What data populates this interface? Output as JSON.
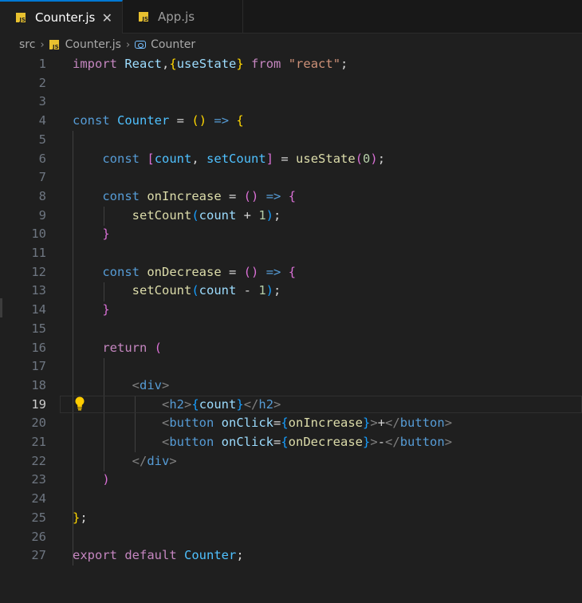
{
  "tabs": [
    {
      "label": "Counter.js",
      "active": true,
      "icon": "js-file-icon"
    },
    {
      "label": "App.js",
      "active": false,
      "icon": "js-file-icon"
    }
  ],
  "breadcrumb": {
    "folder": "src",
    "file": "Counter.js",
    "symbol": "Counter"
  },
  "editor": {
    "current_line": 19,
    "line_numbers": [
      "1",
      "2",
      "3",
      "4",
      "5",
      "6",
      "7",
      "8",
      "9",
      "10",
      "11",
      "12",
      "13",
      "14",
      "15",
      "16",
      "17",
      "18",
      "19",
      "20",
      "21",
      "22",
      "23",
      "24",
      "25",
      "26",
      "27"
    ]
  },
  "code": {
    "l1": {
      "import": "import",
      "react": "React",
      "comma": ",",
      "ob": "{",
      "usestate": "useState",
      "cb": "}",
      "from": "from",
      "module": "\"react\"",
      "semi": ";"
    },
    "l4": {
      "const": "const",
      "name": "Counter",
      "eq": " = ",
      "op": "(",
      "cp": ")",
      "arrow": " => ",
      "ob": "{"
    },
    "l6": {
      "const": "const",
      "ob": "[",
      "count": "count",
      "comma": ", ",
      "setcount": "setCount",
      "cb": "]",
      "eq": " = ",
      "fn": "useState",
      "op": "(",
      "zero": "0",
      "cp": ")",
      "semi": ";"
    },
    "l8": {
      "const": "const",
      "name": "onIncrease",
      "eq": " = ",
      "op": "(",
      "cp": ")",
      "arrow": " => ",
      "ob": "{"
    },
    "l9": {
      "fn": "setCount",
      "op": "(",
      "count": "count",
      "plus": " + ",
      "one": "1",
      "cp": ")",
      "semi": ";"
    },
    "l10": {
      "cb": "}"
    },
    "l12": {
      "const": "const",
      "name": "onDecrease",
      "eq": " = ",
      "op": "(",
      "cp": ")",
      "arrow": " => ",
      "ob": "{"
    },
    "l13": {
      "fn": "setCount",
      "op": "(",
      "count": "count",
      "minus": " - ",
      "one": "1",
      "cp": ")",
      "semi": ";"
    },
    "l14": {
      "cb": "}"
    },
    "l16": {
      "ret": "return",
      "op": " ("
    },
    "l18": {
      "lt": "<",
      "tag": "div",
      "gt": ">"
    },
    "l19": {
      "lt": "<",
      "tag": "h2",
      "gt": ">",
      "ob": "{",
      "count": "count",
      "cb": "}",
      "lt2": "</",
      "tag2": "h2",
      "gt2": ">"
    },
    "l20": {
      "lt": "<",
      "tag": "button",
      "attr": " onClick",
      "eq": "=",
      "ob": "{",
      "handler": "onIncrease",
      "cb": "}",
      "gt": ">",
      "text": "+",
      "lt2": "</",
      "tag2": "button",
      "gt2": ">"
    },
    "l21": {
      "lt": "<",
      "tag": "button",
      "attr": " onClick",
      "eq": "=",
      "ob": "{",
      "handler": "onDecrease",
      "cb": "}",
      "gt": ">",
      "text": "-",
      "lt2": "</",
      "tag2": "button",
      "gt2": ">"
    },
    "l22": {
      "lt": "</",
      "tag": "div",
      "gt": ">"
    },
    "l23": {
      "cp": ")"
    },
    "l25": {
      "cb": "}",
      "semi": ";"
    },
    "l27": {
      "export": "export",
      "default": "default",
      "name": "Counter",
      "semi": ";"
    }
  },
  "colors": {
    "keyword": "#569cd6",
    "control": "#c586c0",
    "variable": "#9cdcfe",
    "constant": "#4fc1ff",
    "function": "#dcdcaa",
    "string": "#ce9178",
    "number": "#b5cea8",
    "bracket1": "#ffd700",
    "bracket2": "#da70d6",
    "bracket3": "#179fff",
    "accent": "#0078d4"
  }
}
